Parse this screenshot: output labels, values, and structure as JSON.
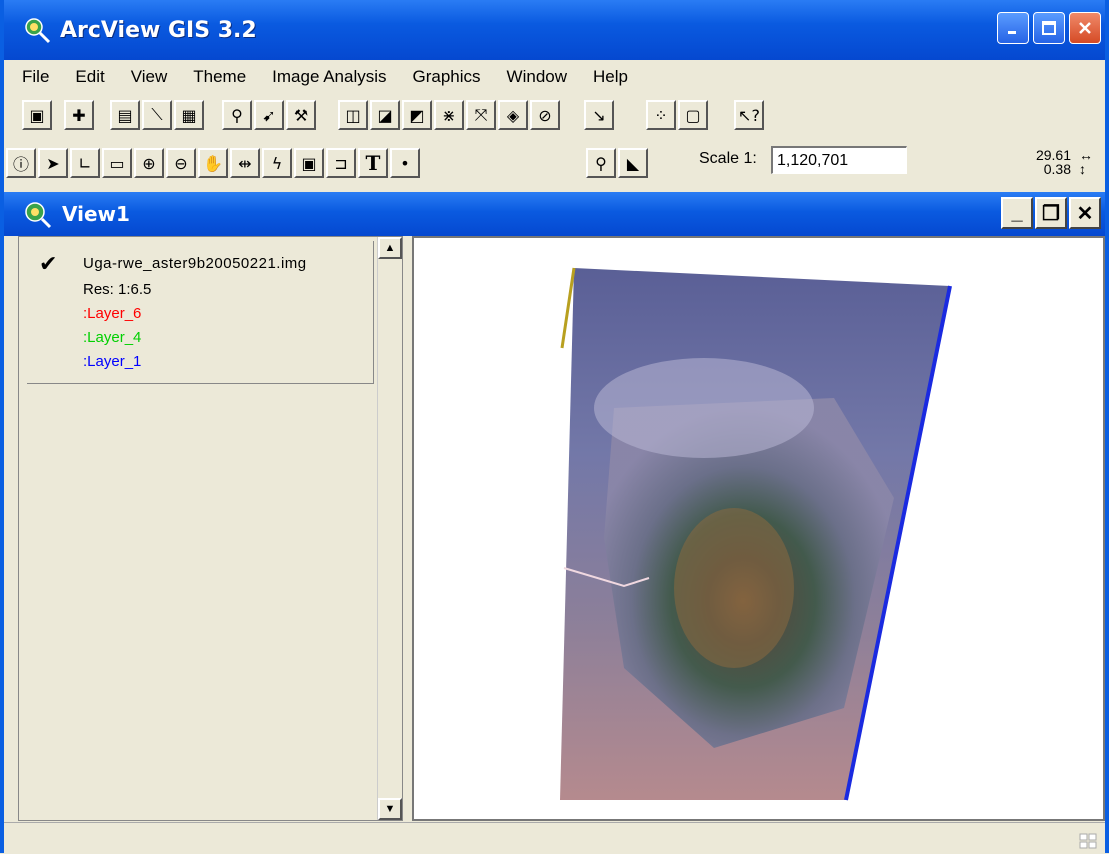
{
  "window": {
    "title": "ArcView GIS 3.2",
    "caption_buttons": [
      "minimize-icon",
      "maximize-icon",
      "close-icon"
    ],
    "accent": "#0a5ae0"
  },
  "menu": [
    {
      "label": "File"
    },
    {
      "label": "Edit"
    },
    {
      "label": "View"
    },
    {
      "label": "Theme"
    },
    {
      "label": "Image Analysis"
    },
    {
      "label": "Graphics"
    },
    {
      "label": "Window"
    },
    {
      "label": "Help"
    }
  ],
  "toolbar1": {
    "buttons": [
      "save-icon",
      "add-theme-icon",
      "theme-properties-icon",
      "edit-legend-icon",
      "open-theme-table-icon",
      "find-icon",
      "locate-address-icon",
      "query-builder-icon",
      "zoom-to-full-extent-icon",
      "zoom-to-active-themes-icon",
      "zoom-to-selected-icon",
      "zoom-in-fixed-icon",
      "zoom-out-fixed-icon",
      "zoom-previous-icon",
      "clear-selected-icon",
      "layout-icon",
      "select-all-icon",
      "graphic-frame-icon",
      "help-icon"
    ]
  },
  "toolbar2": {
    "buttons": [
      "identify-icon",
      "pointer-icon",
      "vertex-edit-icon",
      "select-feature-icon",
      "zoom-in-icon",
      "zoom-out-icon",
      "pan-icon",
      "measure-icon",
      "hot-link-icon",
      "area-of-interest-icon",
      "label-icon",
      "text-icon",
      "draw-point-icon",
      "zoom-to-pixel-icon",
      "rubber-band-icon"
    ],
    "scale_label": "Scale 1:",
    "scale_value": "1,120,701",
    "coord_x": "29.61",
    "coord_y": "0.38"
  },
  "view": {
    "title": "View1",
    "buttons": [
      "minimize-icon",
      "restore-icon",
      "close-icon"
    ]
  },
  "legend": {
    "layer_name": "Uga-rwe_aster9b20050221.img",
    "checked": true,
    "res": "Res: 1:6.5",
    "bands": [
      {
        "label": ":Layer_6",
        "color": "#ff0000"
      },
      {
        "label": ":Layer_4",
        "color": "#00d000"
      },
      {
        "label": ":Layer_1",
        "color": "#0000ff"
      }
    ]
  }
}
